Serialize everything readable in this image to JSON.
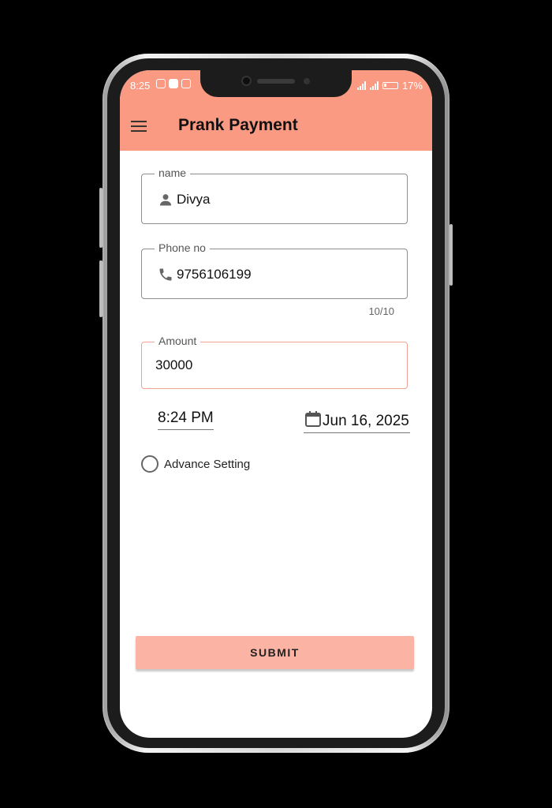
{
  "status_bar": {
    "time": "8:25",
    "battery": "17%"
  },
  "app_bar": {
    "title": "Prank Payment"
  },
  "form": {
    "name": {
      "label": "name",
      "value": "Divya"
    },
    "phone": {
      "label": "Phone no",
      "value": "9756106199",
      "counter": "10/10"
    },
    "amount": {
      "label": "Amount",
      "value": "30000"
    },
    "time": "8:24 PM",
    "date": "Jun 16, 2025",
    "advance_setting": "Advance Setting",
    "submit_label": "SUBMIT"
  },
  "colors": {
    "accent": "#fb9a82",
    "button": "#fbb3a4",
    "focus_border": "#f2a594"
  }
}
